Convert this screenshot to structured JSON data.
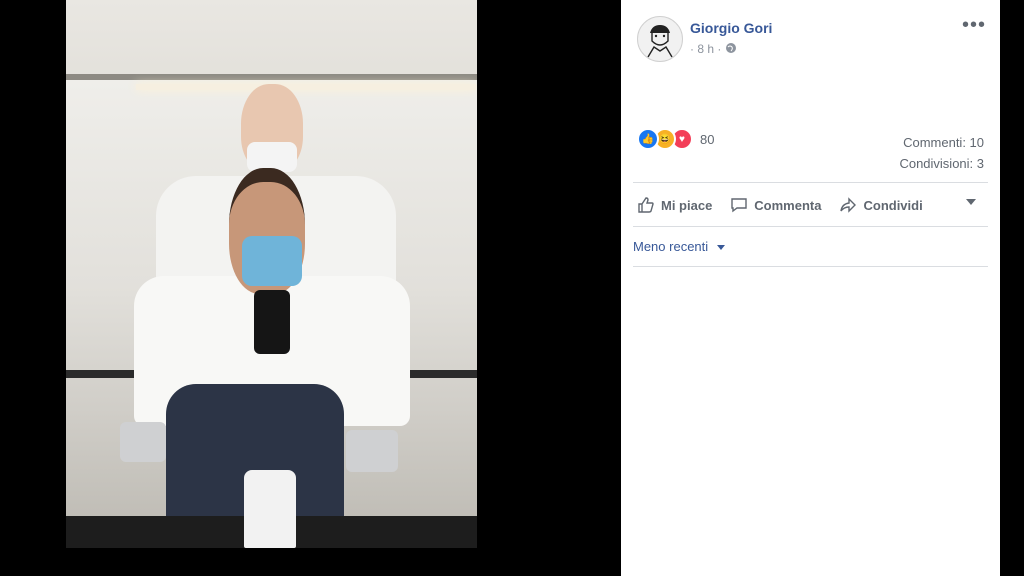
{
  "post": {
    "author": "Giorgio Gori",
    "time": "8 h",
    "separator": "·",
    "privacy_icon": "globe-icon",
    "more_label": "•••"
  },
  "reactions": {
    "icons": [
      "like-icon",
      "haha-icon",
      "love-icon"
    ],
    "count": "80"
  },
  "stats": {
    "comments": "Commenti: 10",
    "shares": "Condivisioni: 3"
  },
  "actions": {
    "like": "Mi piace",
    "comment": "Commenta",
    "share": "Condividi"
  },
  "filter": {
    "label": "Meno recenti"
  },
  "colors": {
    "link": "#385898",
    "muted": "#606770",
    "like": "#1877f2",
    "haha": "#f7b125",
    "love": "#f33e58"
  }
}
